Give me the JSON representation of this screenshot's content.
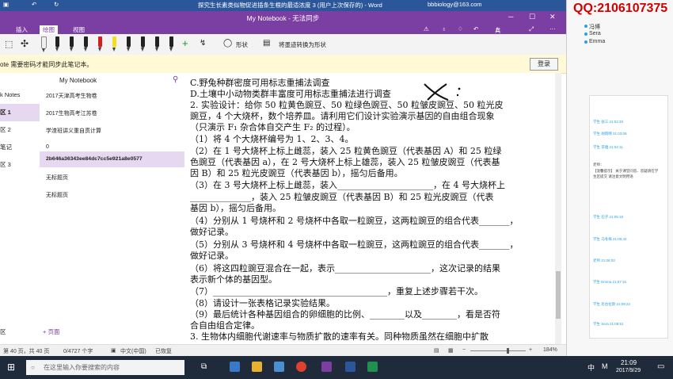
{
  "word_titlebar": {
    "title": "探究生长素类似物促进插条生根的最适浓度 3 (用户上次保存的) - Word",
    "account": "bbbiology@163.com"
  },
  "onenote": {
    "window_title": "My Notebook - 无法同步",
    "tabs": [
      "插入",
      "绘图",
      "视图"
    ],
    "share_label": "共享",
    "ribbon": {
      "shapes_label": "形状",
      "ink_to_shape_label": "将墨迹转换为形状"
    },
    "message": "ote 需要密码才能同步此笔记本。",
    "login_label": "登录",
    "notebook_name": "My Notebook",
    "sections": [
      "k Notes",
      "区 1",
      "区 2",
      "笔记",
      "区 3"
    ],
    "pages": [
      "2017天津高考生物卷",
      "2017生物高考江苏卷",
      "学渣班讲义重自贯计算",
      "0",
      "2b646a36343ee84dc7cc5e921a8e0577",
      "无标题页",
      "无标题页"
    ],
    "add_section": "区",
    "add_page": "+ 页面"
  },
  "document": {
    "lines": [
      "C.野兔种群密度可用标志重捕法调查",
      "D.土壤中小动物类群丰富度可用标志重捕法进行调查",
      "2. 实验设计：给你 50 粒黄色豌豆、50 粒绿色豌豆、50 粒皱皮豌豆、50 粒光皮",
      "豌豆，4 个大烧杯，数个培养皿。请利用它们设计实验演示基因的自由组合现象",
      "（只演示 F₁ 杂合体自交产生 F₂ 的过程）。",
      "（1）将 4 个大烧杯编号为 1、2、3、4。",
      "（2）在 1 号大烧杯上标上雌蕊，装入 25 粒黄色豌豆（代表基因 A）和 25 粒绿",
      "色豌豆（代表基因 a），在 2 号大烧杯上标上雄蕊，装入 25 粒皱皮豌豆（代表基",
      "因 B）和 25 粒光皮豌豆（代表基因 b），摇匀后备用。",
      "（3）在 3 号大烧杯上标上雌蕊，装入______________________，在 4 号大烧杯上",
      "______________，装入 25 粒皱皮豌豆（代表基因 B）和 25 粒光皮豌豆（代表",
      "基因 b），摇匀后备用。",
      "（4）分别从 1 号烧杯和 2 号烧杯中各取一粒豌豆，这两粒豌豆的组合代表_______，",
      "做好记录。",
      "（5）分别从 3 号烧杯和 4 号烧杯中各取一粒豌豆，这两粒豌豆的组合代表_______，",
      "做好记录。",
      "（6）将这四粒豌豆混合在一起，表示______________________，这次记录的结果",
      "表示新个体的基因型。",
      "（7）________________________________________，重复上述步骤若干次。",
      "（8）请设计一张表格记录实验结果。",
      "（9）最后统计各种基因组合的卵细胞的比例、________以及________，看是否符",
      "合自由组合定律。",
      "3. 生物体内细胞代谢速率与物质扩散的速率有关。同种物质虽然在细胞中扩散"
    ]
  },
  "statusbar": {
    "page": "第 40 页，共 40 页",
    "words": "0/4727 个字",
    "lang": "中文(中国)",
    "state": "已恢复",
    "zoom": "184%"
  },
  "taskbar": {
    "search_placeholder": "在这里输入你要搜索的内容",
    "ime1": "中",
    "ime2": "M",
    "time": "21:09",
    "date": "2017/9/29"
  },
  "right_panel": {
    "qq_label": "QQ:2106107375",
    "users": [
      "冯博",
      "Sera",
      "Emma"
    ],
    "chat_lines": [
      "学生 张三 21:02:30",
      "学生 胡雨晴 21:03:09",
      "学生 李雅 21:04:11",
      "老师：",
      "【温馨提示】 关于课堂问答、答疑请在学",
      "生区提交 请注意文明用语",
      "学生 石子 21:05:18",
      "学生 马冬梅 21:05:42",
      "老师 21:06:03",
      "学生 Emma 21:07:15",
      "学生 尼古拉斯 21:08:22",
      "学生 Sera 21:08:51"
    ]
  }
}
